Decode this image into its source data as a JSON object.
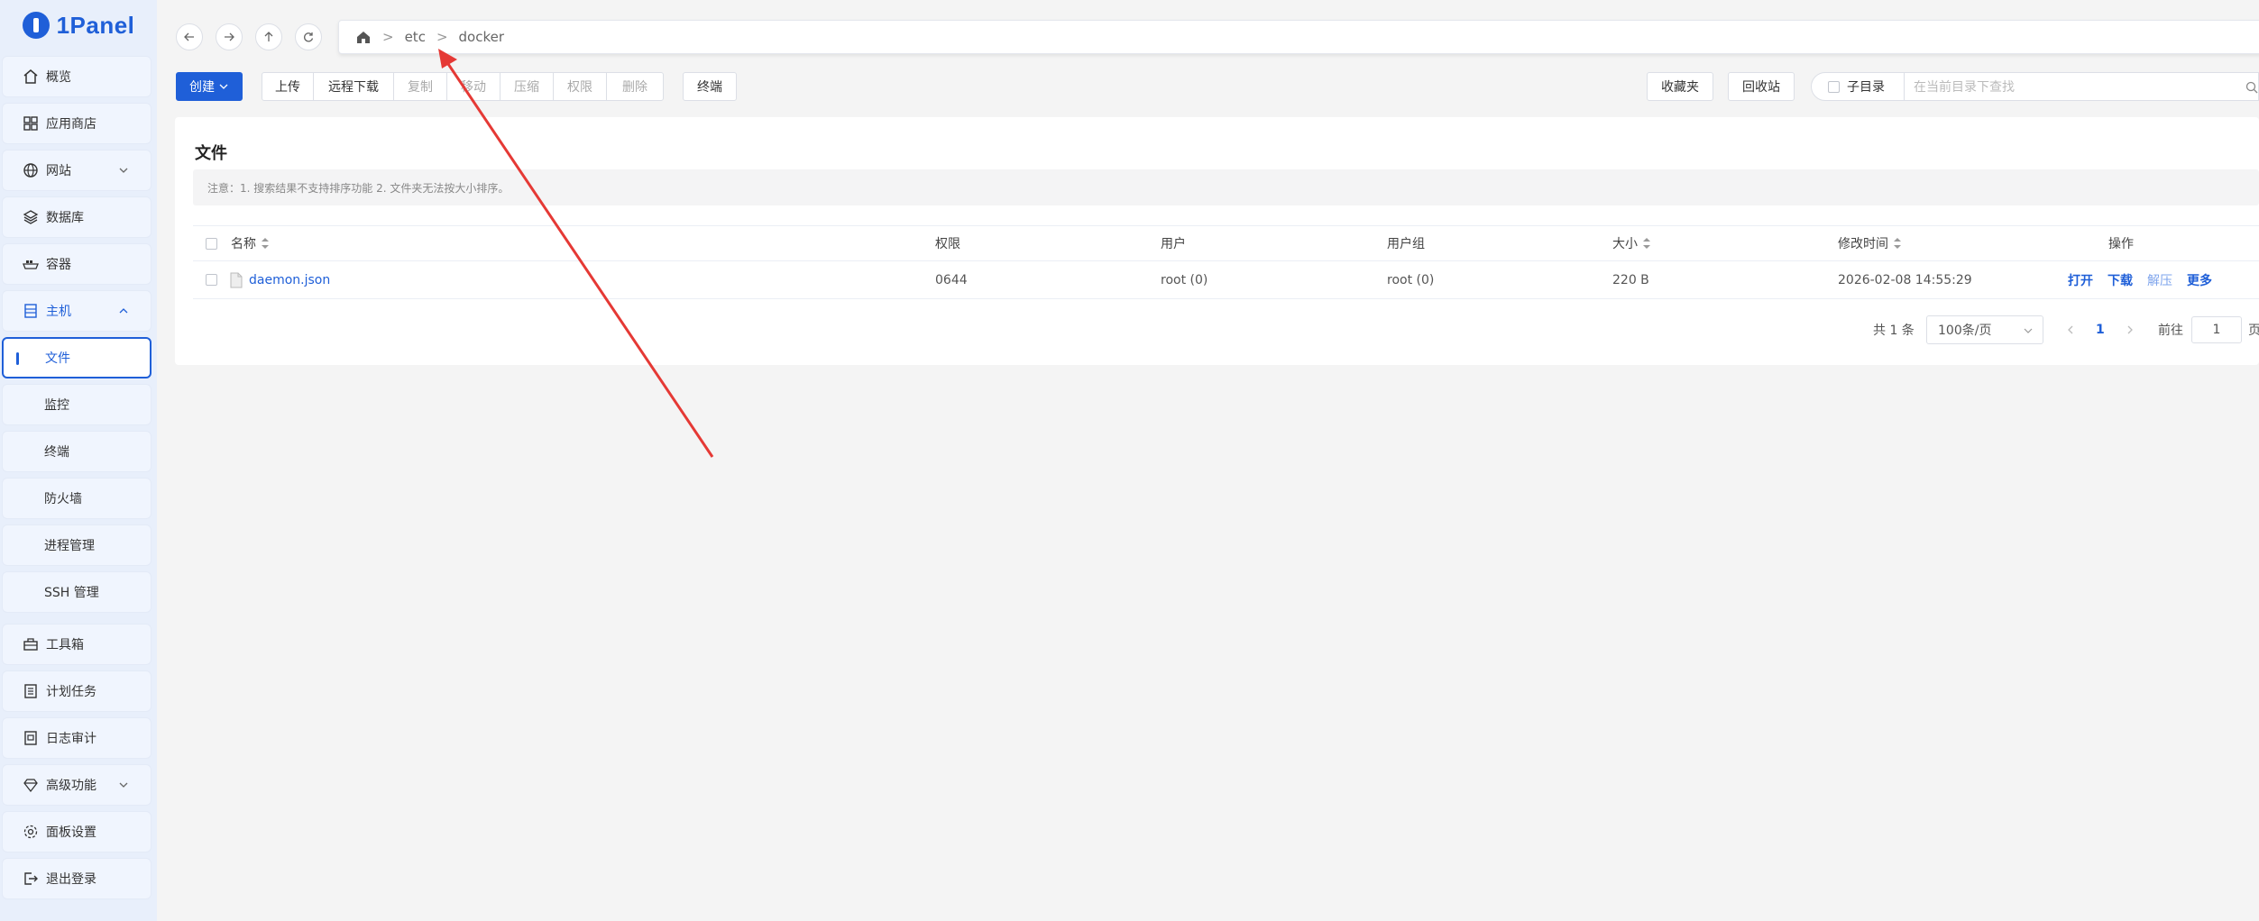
{
  "app": {
    "logo_text": "1Panel"
  },
  "sidebar": {
    "items": [
      {
        "label": "概览",
        "icon": "home-icon"
      },
      {
        "label": "应用商店",
        "icon": "apps-grid-icon"
      },
      {
        "label": "网站",
        "icon": "globe-icon"
      },
      {
        "label": "数据库",
        "icon": "database-layers-icon"
      },
      {
        "label": "容器",
        "icon": "container-ship-icon"
      },
      {
        "label": "主机",
        "icon": "server-icon"
      },
      {
        "label": "文件"
      },
      {
        "label": "监控"
      },
      {
        "label": "终端"
      },
      {
        "label": "防火墙"
      },
      {
        "label": "进程管理"
      },
      {
        "label": "SSH 管理"
      },
      {
        "label": "工具箱",
        "icon": "toolbox-icon"
      },
      {
        "label": "计划任务",
        "icon": "list-icon"
      },
      {
        "label": "日志审计",
        "icon": "log-icon"
      },
      {
        "label": "高级功能",
        "icon": "diamond-icon"
      },
      {
        "label": "面板设置",
        "icon": "gear-icon"
      },
      {
        "label": "退出登录",
        "icon": "logout-icon"
      }
    ]
  },
  "path": {
    "segments": [
      "etc",
      "docker"
    ],
    "separator": ">"
  },
  "toolbar": {
    "create": "创建",
    "upload": "上传",
    "remote_download": "远程下载",
    "copy": "复制",
    "move": "移动",
    "compress": "压缩",
    "permission": "权限",
    "delete": "删除",
    "terminal": "终端",
    "favorites": "收藏夹",
    "recycle_bin": "回收站",
    "subdir_label": "子目录",
    "search_placeholder": "在当前目录下查找"
  },
  "card": {
    "title": "文件",
    "notice": "注意：1. 搜索结果不支持排序功能 2. 文件夹无法按大小排序。"
  },
  "table": {
    "headers": {
      "name": "名称",
      "permission": "权限",
      "user": "用户",
      "group": "用户组",
      "size": "大小",
      "modified": "修改时间",
      "actions": "操作"
    },
    "rows": [
      {
        "name": "daemon.json",
        "permission": "0644",
        "user": "root (0)",
        "group": "root (0)",
        "size": "220 B",
        "modified": "2026-02-08 14:55:29",
        "actions": {
          "open": "打开",
          "download": "下载",
          "extract": "解压",
          "more": "更多"
        }
      }
    ]
  },
  "pagination": {
    "total": "共 1 条",
    "page_size": "100条/页",
    "current_page": "1",
    "goto_label": "前往",
    "goto_value": "1",
    "page_suffix": "页"
  },
  "colors": {
    "accent": "#1f5fd8",
    "annotation_arrow": "#e53935"
  }
}
